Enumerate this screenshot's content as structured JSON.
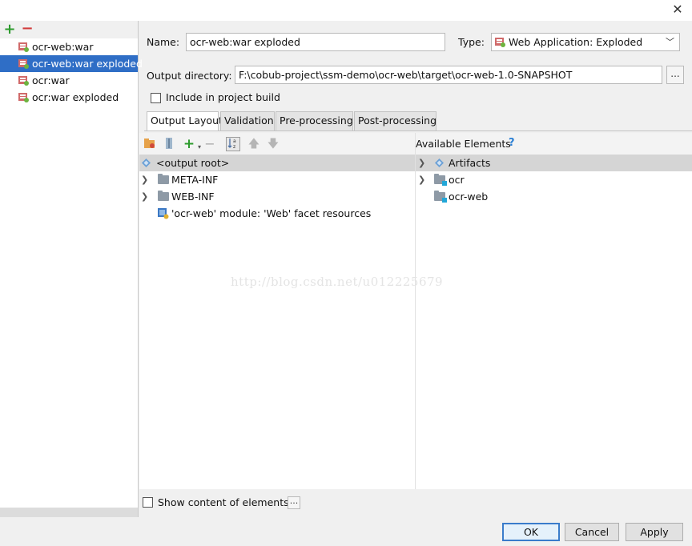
{
  "window": {
    "close_symbol": "✕"
  },
  "artifacts": {
    "add_symbol": "+",
    "remove_symbol": "−",
    "items": [
      {
        "label": "ocr-web:war",
        "selected": false
      },
      {
        "label": "ocr-web:war exploded",
        "selected": true
      },
      {
        "label": "ocr:war",
        "selected": false
      },
      {
        "label": "ocr:war exploded",
        "selected": false
      }
    ]
  },
  "form": {
    "name_label": "Name:",
    "name_value": "ocr-web:war exploded",
    "type_label": "Type:",
    "type_value": "Web Application: Exploded",
    "output_dir_label": "Output directory:",
    "output_dir_value": "F:\\cobub-project\\ssm-demo\\ocr-web\\target\\ocr-web-1.0-SNAPSHOT",
    "browse_label": "...",
    "include_build_label": "Include in project build"
  },
  "tabs": [
    {
      "label": "Output Layout",
      "active": true
    },
    {
      "label": "Validation",
      "active": false
    },
    {
      "label": "Pre-processing",
      "active": false
    },
    {
      "label": "Post-processing",
      "active": false
    }
  ],
  "output_tree": {
    "root_label": "<output root>",
    "items": [
      {
        "label": "META-INF",
        "expandable": true
      },
      {
        "label": "WEB-INF",
        "expandable": true
      },
      {
        "label": "'ocr-web' module: 'Web' facet resources",
        "expandable": false
      }
    ]
  },
  "available": {
    "header": "Available Elements",
    "help_symbol": "?",
    "root_label": "Artifacts",
    "items": [
      {
        "label": "ocr",
        "expandable": true
      },
      {
        "label": "ocr-web",
        "expandable": false
      }
    ]
  },
  "watermark": "http://blog.csdn.net/u012225679",
  "bottom": {
    "show_content_label": "Show content of elements",
    "show_content_more": "..."
  },
  "buttons": {
    "ok": "OK",
    "cancel": "Cancel",
    "apply": "Apply"
  },
  "colors": {
    "selection": "#2f6ec6",
    "add_green": "#2e9b2e",
    "remove_red": "#d23b3b",
    "help_blue": "#2a7fd4"
  }
}
